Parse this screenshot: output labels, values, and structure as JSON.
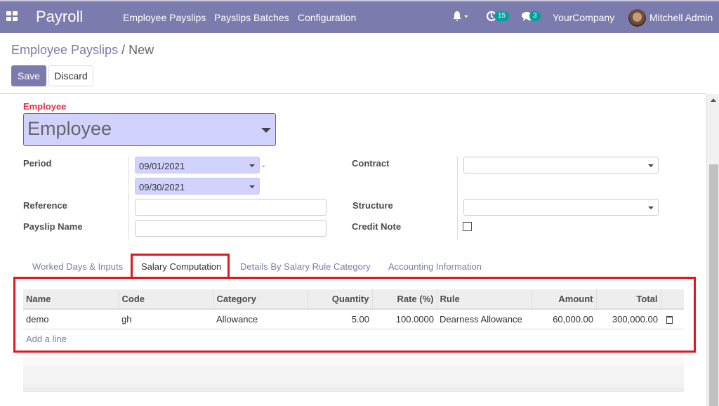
{
  "navbar": {
    "app_name": "Payroll",
    "menu": [
      "Employee Payslips",
      "Payslips Batches",
      "Configuration"
    ],
    "activity_count": "15",
    "message_count": "3",
    "company": "YourCompany",
    "user": "Mitchell Admin"
  },
  "breadcrumb": {
    "parent": "Employee Payslips",
    "separator": " / ",
    "current": "New"
  },
  "toolbar": {
    "save_label": "Save",
    "discard_label": "Discard"
  },
  "form": {
    "employee_label": "Employee",
    "employee_placeholder": "Employee",
    "period_label": "Period",
    "date_from": "09/01/2021",
    "date_sep": "-",
    "date_to": "09/30/2021",
    "reference_label": "Reference",
    "reference_value": "",
    "payslip_name_label": "Payslip Name",
    "payslip_name_value": "",
    "contract_label": "Contract",
    "contract_value": "",
    "structure_label": "Structure",
    "structure_value": "",
    "credit_note_label": "Credit Note",
    "credit_note_checked": false
  },
  "tabs": [
    {
      "label": "Worked Days & Inputs",
      "active": false
    },
    {
      "label": "Salary Computation",
      "active": true
    },
    {
      "label": "Details By Salary Rule Category",
      "active": false
    },
    {
      "label": "Accounting Information",
      "active": false
    }
  ],
  "table": {
    "columns": [
      "Name",
      "Code",
      "Category",
      "Quantity",
      "Rate (%)",
      "Rule",
      "Amount",
      "Total"
    ],
    "rows": [
      {
        "name": "demo",
        "code": "gh",
        "category": "Allowance",
        "quantity": "5.00",
        "rate": "100.0000",
        "rule": "Dearness Allowance",
        "amount": "60,000.00",
        "total": "300,000.00"
      }
    ],
    "add_line": "Add a line"
  },
  "colors": {
    "brand": "#7c7bad",
    "highlight": "#e3161e",
    "badge": "#00a09d",
    "required": "#dc3545"
  }
}
